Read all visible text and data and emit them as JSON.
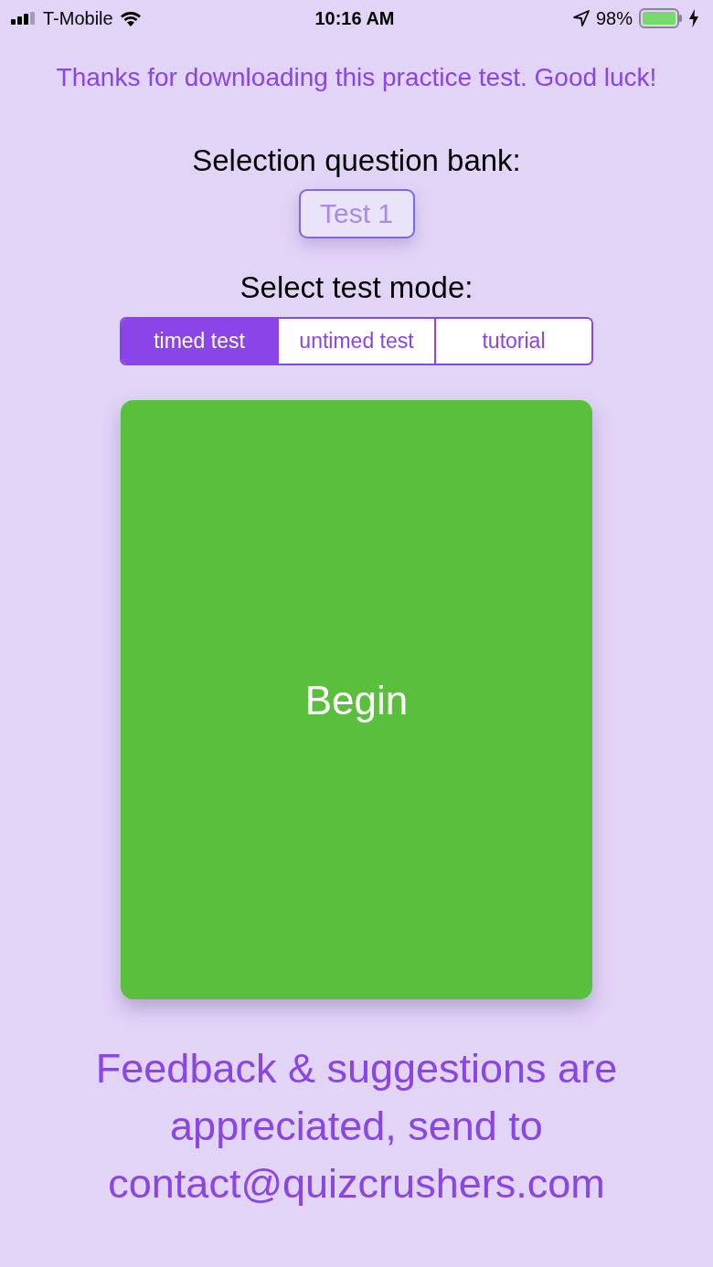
{
  "status_bar": {
    "carrier": "T-Mobile",
    "time": "10:16 AM",
    "battery": "98%"
  },
  "intro": "Thanks for downloading this practice test. Good luck!",
  "bank": {
    "label": "Selection question bank:",
    "button": "Test 1"
  },
  "mode": {
    "label": "Select test mode:",
    "tabs": [
      {
        "label": "timed test",
        "selected": true
      },
      {
        "label": "untimed test",
        "selected": false
      },
      {
        "label": "tutorial",
        "selected": false
      }
    ]
  },
  "card": {
    "button": "Begin"
  },
  "feedback": "Feedback & suggestions are appreciated, send to contact@quizcrushers.com"
}
